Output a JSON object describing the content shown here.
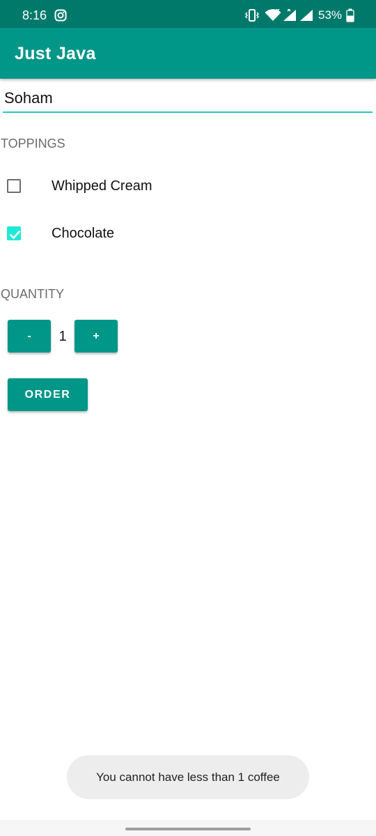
{
  "status_bar": {
    "time": "8:16",
    "battery": "53%",
    "icons": [
      "instagram-icon",
      "vibrate-icon",
      "wifi-icon",
      "signal-icon",
      "signal-icon",
      "battery-icon"
    ]
  },
  "app_bar": {
    "title": "Just Java"
  },
  "name_field": {
    "value": "Soham"
  },
  "toppings": {
    "header": "TOPPINGS",
    "items": [
      {
        "label": "Whipped Cream",
        "checked": false
      },
      {
        "label": "Chocolate",
        "checked": true
      }
    ]
  },
  "quantity": {
    "header": "QUANTITY",
    "decrement_label": "-",
    "value": "1",
    "increment_label": "+"
  },
  "order_button": {
    "label": "ORDER"
  },
  "toast": {
    "message": "You cannot have less than 1 coffee"
  },
  "colors": {
    "primary": "#009688",
    "primary_dark": "#00796b",
    "accent": "#1de9d6"
  }
}
